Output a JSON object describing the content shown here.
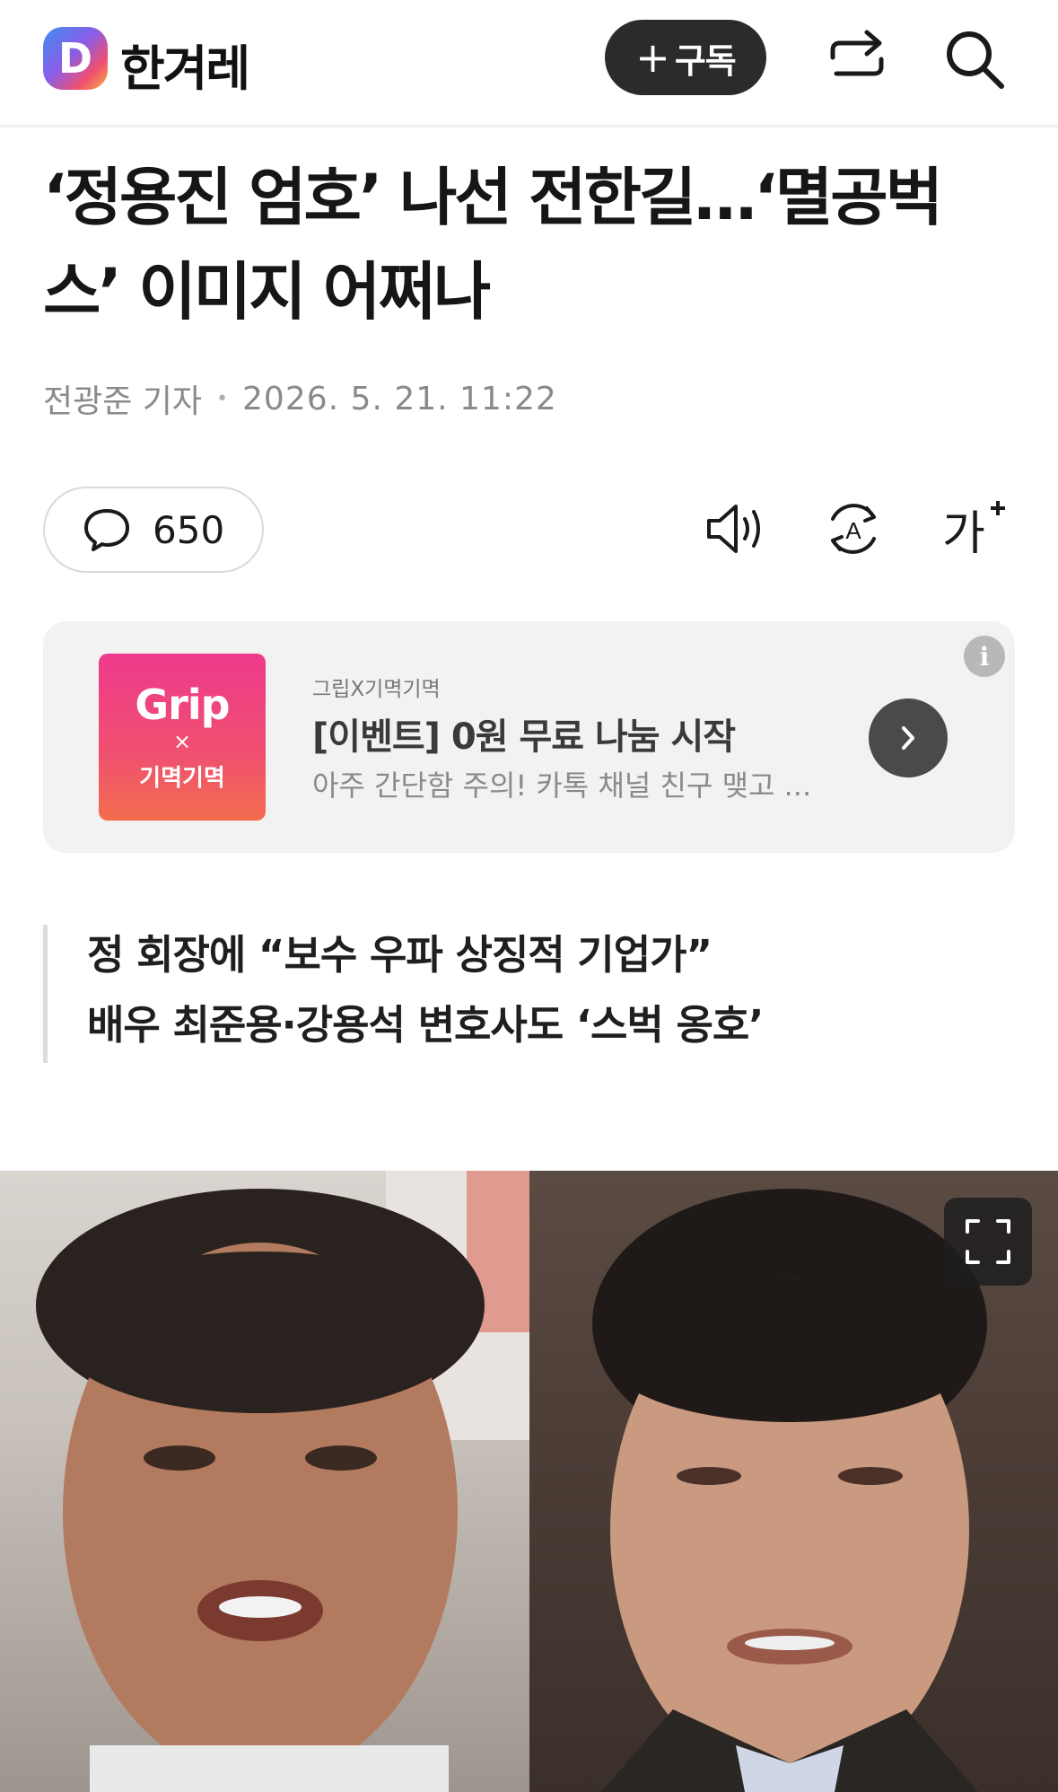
{
  "header": {
    "logo_letter": "D",
    "brand_name": "한겨레",
    "subscribe_label": "구독"
  },
  "article": {
    "headline_line1": "‘정용진 엄호’ 나선 전한길…‘멸공벅",
    "headline_line2": "스’ 이미지 어쩌나",
    "author": "전광준 기자",
    "datetime": "2026. 5. 21. 11:22",
    "comment_count": "650",
    "subheadings": [
      "정 회장에 “보수 우파 상징적 기업가”",
      "배우 최준용·강용석 변호사도 ‘스벅 옹호’"
    ]
  },
  "ad": {
    "thumb_title": "Grip",
    "thumb_x": "×",
    "thumb_brand": "기멱기멱",
    "sponsor": "그립X기멱기멱",
    "title": "[이벤트] 0원 무료 나눔 시작",
    "description": "아주 간단함 주의! 카톡 채널 친구 맺고 ...",
    "info_label": "i"
  },
  "toolbar": {
    "font_size_label": "가"
  },
  "colors": {
    "subscribe_bg": "#2b2b2b",
    "ad_bg": "#f2f2f2",
    "ad_thumb": "#ee3a8c"
  }
}
